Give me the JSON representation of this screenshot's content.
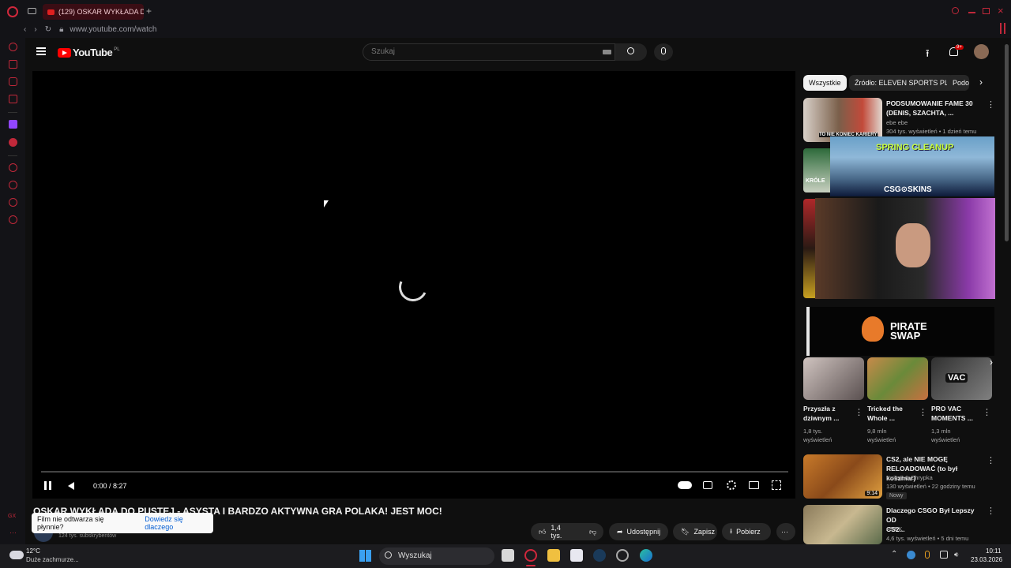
{
  "browser": {
    "tab_title": "(129) OSKAR WYKŁADA D",
    "url": "www.youtube.com/watch"
  },
  "youtube": {
    "logo_text": "YouTube",
    "logo_region": "PL",
    "search_placeholder": "Szukaj",
    "notifications_badge": "9+"
  },
  "player": {
    "time": "0:00 / 8:27"
  },
  "video": {
    "title": "OSKAR WYKŁADA DO PUSTEJ - ASYSTA I BARDZO AKTYWNA GRA POLAKA! JEST MOC!",
    "subscribers": "124 tys. subskrybentów",
    "like_count": "1,4 tys.",
    "share_label": "Udostępnij",
    "save_label": "Zapisz",
    "download_label": "Pobierz"
  },
  "toast": {
    "message": "Film nie odtwarza się płynnie?",
    "link": "Dowiedz się dlaczego"
  },
  "chips": [
    "Wszystkie",
    "Źródło: ELEVEN SPORTS PL",
    "Podo"
  ],
  "recommendations": [
    {
      "title_1": "PODSUMOWANIE FAME 30",
      "title_2": "(DENIS, SZACHTA, ...",
      "channel": "ebe ebe",
      "meta": "304 tys. wyświetleń • 1 dzień temu"
    },
    {
      "title_1": "CS2, ale NIE MOGĘ",
      "title_2": "RELOADOWAĆ (to był koszmar)",
      "channel": "KuTaZ & Chrypka",
      "meta": "130 wyświetleń • 22 godziny temu",
      "badge": "Nowy",
      "duration": "9:14"
    },
    {
      "title_1": "Dlaczego CSGO Był Lepszy OD",
      "title_2": "CS2...",
      "channel": "ADEK",
      "meta": "4,6 tys. wyświetleń • 5 dni temu"
    }
  ],
  "ads": {
    "spring_cleanup": "SPRING CLEANUP",
    "csg_skins": "CSG⊙SKINS",
    "pirate_swap_1": "PIRATE",
    "pirate_swap_2": "SWAP",
    "thumb_text_1": "TO NIE KONIEC KARIERY!",
    "thumb_text_2": "KRÓLE"
  },
  "shorts": [
    {
      "title_1": "Przyszła z",
      "title_2": "dziwnym ...",
      "views_1": "1,8 tys.",
      "views_2": "wyświetleń"
    },
    {
      "title_1": "Tricked the",
      "title_2": "Whole ...",
      "views_1": "9,8 mln",
      "views_2": "wyświetleń"
    },
    {
      "title_1": "PRO VAC",
      "title_2": "MOMENTS ...",
      "views_1": "1,3 mln",
      "views_2": "wyświetleń",
      "overlay": "VAC"
    }
  ],
  "taskbar": {
    "temperature": "12°C",
    "weather": "Duże zachmurze...",
    "search": "Wyszukaj",
    "time": "10:11",
    "date": "23.03.2026"
  },
  "colors": {
    "opera_red": "#c0283a",
    "youtube_red": "#ff0000",
    "link_blue": "#065fd4"
  }
}
